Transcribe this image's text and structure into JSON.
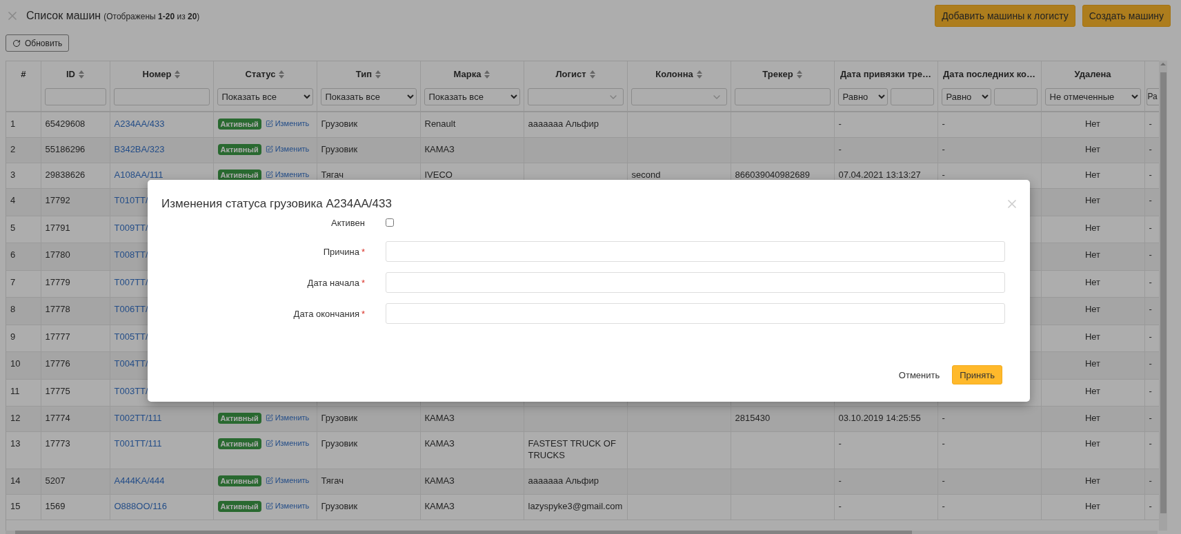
{
  "header": {
    "title": "Список машин",
    "subtitle": "(Отображены **1-20** из **20**)",
    "buttons": [
      "Добавить машины к логисту",
      "Создать машину"
    ]
  },
  "toolbar": {
    "refresh": "Обновить"
  },
  "table": {
    "columns": [
      {
        "label": "#",
        "sortable": false
      },
      {
        "label": "ID",
        "sortable": true,
        "filter": {
          "kind": "text"
        }
      },
      {
        "label": "Номер",
        "sortable": true,
        "filter": {
          "kind": "text"
        }
      },
      {
        "label": "Статус",
        "sortable": true,
        "filter": {
          "kind": "select",
          "value": "Показать все"
        }
      },
      {
        "label": "Тип",
        "sortable": true,
        "filter": {
          "kind": "select",
          "value": "Показать все"
        }
      },
      {
        "label": "Марка",
        "sortable": true,
        "filter": {
          "kind": "select",
          "value": "Показать все"
        }
      },
      {
        "label": "Логист",
        "sortable": true,
        "filter": {
          "kind": "combo"
        }
      },
      {
        "label": "Колонна",
        "sortable": true,
        "filter": {
          "kind": "combo"
        }
      },
      {
        "label": "Трекер",
        "sortable": true,
        "filter": {
          "kind": "text"
        }
      },
      {
        "label": "Дата привязки тре…",
        "sortable": false,
        "filter": {
          "kind": "compare",
          "value": "Равно"
        }
      },
      {
        "label": "Дата последних ко…",
        "sortable": false,
        "filter": {
          "kind": "compare",
          "value": "Равно"
        }
      },
      {
        "label": "Удалена",
        "sortable": false,
        "filter": {
          "kind": "select",
          "value": "Не отмеченные"
        }
      },
      {
        "sortable": false,
        "filter": {
          "kind": "select",
          "value": "Ра"
        }
      }
    ],
    "rows": [
      {
        "n": "1",
        "id": "65429608",
        "plate": "A234AA/433",
        "status": {
          "label": "Активный",
          "action": "Изменить"
        },
        "type": "Грузовик",
        "brand": "Renault",
        "logist": "ааааааа Альфир",
        "bound_at": "-",
        "last_at": "-",
        "deleted": "Нет",
        "extra": "-"
      },
      {
        "n": "2",
        "id": "55186296",
        "plate": "B342BA/323",
        "status": {
          "label": "Активный",
          "action": "Изменить"
        },
        "type": "Грузовик",
        "brand": "КАМАЗ",
        "bound_at": "-",
        "last_at": "-",
        "deleted": "Нет",
        "extra": "-"
      },
      {
        "n": "3",
        "id": "29838626",
        "plate": "A108AA/111",
        "status": {
          "label": "Активный",
          "action": "Изменить"
        },
        "type": "Тягач",
        "brand": "IVECO",
        "convoy": "second",
        "tracker": "866039040982689",
        "bound_at": "07.04.2021 13:13:27",
        "last_at": "-",
        "deleted": "Нет",
        "extra": "-"
      },
      {
        "n": "4",
        "id": "17792",
        "plate": "T010TT/",
        "deleted": "Нет",
        "extra": "-"
      },
      {
        "n": "5",
        "id": "17791",
        "plate": "T009TT/",
        "deleted": "Нет",
        "extra": "-"
      },
      {
        "n": "6",
        "id": "17780",
        "plate": "T008TT/",
        "deleted": "Нет",
        "extra": "-"
      },
      {
        "n": "7",
        "id": "17779",
        "plate": "T007TT/",
        "deleted": "Нет",
        "extra": "-"
      },
      {
        "n": "8",
        "id": "17778",
        "plate": "T006TT/",
        "deleted": "Нет",
        "extra": "-"
      },
      {
        "n": "9",
        "id": "17777",
        "plate": "T005TT/",
        "deleted": "Нет",
        "extra": "-"
      },
      {
        "n": "10",
        "id": "17776",
        "plate": "T004TT/",
        "deleted": "Нет",
        "extra": "-"
      },
      {
        "n": "11",
        "id": "17775",
        "plate": "T003TT/",
        "deleted": "Нет",
        "extra": "-"
      },
      {
        "n": "12",
        "id": "17774",
        "plate": "T002TT/111",
        "status": {
          "label": "Активный",
          "action": "Изменить"
        },
        "type": "Грузовик",
        "brand": "КАМАЗ",
        "tracker": "2815430",
        "bound_at": "03.10.2019 14:25:55",
        "last_at": "-",
        "deleted": "Нет",
        "extra": "-"
      },
      {
        "n": "13",
        "id": "17773",
        "plate": "T001TT/111",
        "status": {
          "label": "Активный",
          "action": "Изменить"
        },
        "type": "Грузовик",
        "brand": "КАМАЗ",
        "logist": "FASTEST TRUCK OF TRUCKS",
        "bound_at": "-",
        "last_at": "-",
        "deleted": "Нет",
        "extra": "-"
      },
      {
        "n": "14",
        "id": "5207",
        "plate": "A444KA/444",
        "status": {
          "label": "Активный",
          "action": "Изменить"
        },
        "type": "Тягач",
        "brand": "КАМАЗ",
        "logist": "ааааааа Альфир",
        "bound_at": "-",
        "last_at": "-",
        "deleted": "Нет",
        "extra": "-"
      },
      {
        "n": "15",
        "id": "1569",
        "plate": "O888OO/116",
        "status": {
          "label": "Активный",
          "action": "Изменить"
        },
        "type": "Грузовик",
        "brand": "КАМАЗ",
        "logist": "lazyspyke3@gmail.com",
        "bound_at": "-",
        "last_at": "-",
        "deleted": "Нет",
        "extra": "-"
      }
    ]
  },
  "modal": {
    "title": "Изменения статуса грузовика A234AA/433",
    "fields": [
      {
        "kind": "checkbox",
        "label": "Активен",
        "checked": false
      },
      {
        "kind": "text",
        "label": "Причина",
        "required_mark": "*"
      },
      {
        "kind": "text",
        "label": "Дата начала",
        "required_mark": "*"
      },
      {
        "kind": "text",
        "label": "Дата окончания",
        "required_mark": "*"
      }
    ],
    "cancel": "Отменить",
    "accept": "Принять"
  }
}
